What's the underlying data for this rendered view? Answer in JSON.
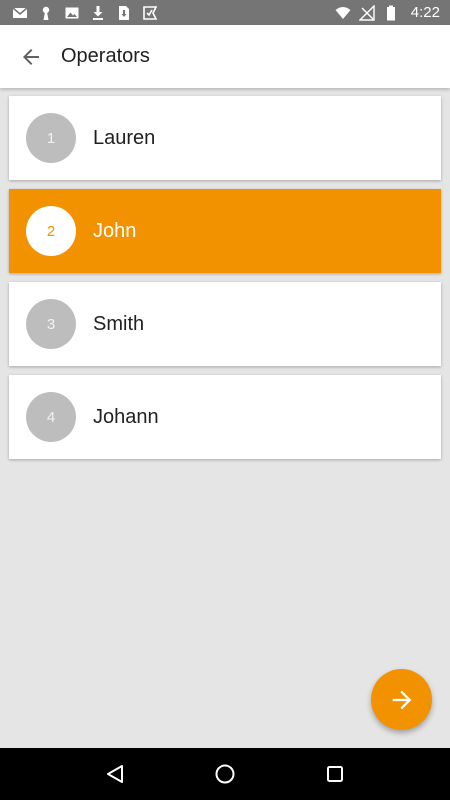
{
  "status_bar": {
    "time": "4:22",
    "left_icons": [
      "gmail-icon",
      "keyhole-icon",
      "image-icon",
      "download-icon",
      "sim-download-icon",
      "checkmark-app-icon"
    ],
    "right_icons": [
      "wifi-icon",
      "no-signal-icon",
      "battery-icon"
    ]
  },
  "app_bar": {
    "title": "Operators",
    "back_icon": "arrow-back-icon"
  },
  "operators": [
    {
      "number": "1",
      "name": "Lauren",
      "selected": false
    },
    {
      "number": "2",
      "name": "John",
      "selected": true
    },
    {
      "number": "3",
      "name": "Smith",
      "selected": false
    },
    {
      "number": "4",
      "name": "Johann",
      "selected": false
    }
  ],
  "fab": {
    "icon": "arrow-forward-icon"
  },
  "nav_bar": {
    "icons": [
      "nav-back-icon",
      "nav-home-icon",
      "nav-recents-icon"
    ]
  },
  "colors": {
    "accent": "#f39200",
    "status_bar": "#757575",
    "background": "#e5e5e5",
    "avatar_inactive": "#bdbdbd"
  }
}
